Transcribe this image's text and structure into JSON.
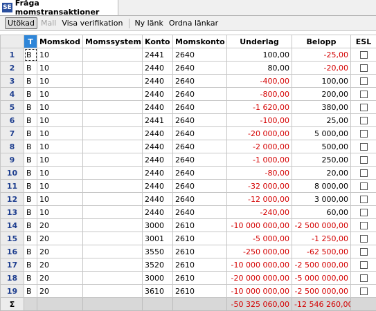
{
  "tab": {
    "icon_text": "SE",
    "title": "Fråga momstransaktioner"
  },
  "toolbar": {
    "expanded": "Utökad",
    "template": "Mall",
    "show_verification": "Visa verifikation",
    "new_link": "Ny länk",
    "arrange_links": "Ordna länkar"
  },
  "columns": {
    "t": "T",
    "momskod": "Momskod",
    "momssystem": "Momssystem",
    "konto": "Konto",
    "momskonto": "Momskonto",
    "underlag": "Underlag",
    "belopp": "Belopp",
    "esl": "ESL"
  },
  "rows": [
    {
      "n": "1",
      "t": "B",
      "kod": "10",
      "sys": "",
      "konto": "2441",
      "mk": "2640",
      "und": "100,00",
      "bel": "-25,00"
    },
    {
      "n": "2",
      "t": "B",
      "kod": "10",
      "sys": "",
      "konto": "2440",
      "mk": "2640",
      "und": "80,00",
      "bel": "-20,00"
    },
    {
      "n": "3",
      "t": "B",
      "kod": "10",
      "sys": "",
      "konto": "2440",
      "mk": "2640",
      "und": "-400,00",
      "bel": "100,00"
    },
    {
      "n": "4",
      "t": "B",
      "kod": "10",
      "sys": "",
      "konto": "2440",
      "mk": "2640",
      "und": "-800,00",
      "bel": "200,00"
    },
    {
      "n": "5",
      "t": "B",
      "kod": "10",
      "sys": "",
      "konto": "2440",
      "mk": "2640",
      "und": "-1 620,00",
      "bel": "380,00"
    },
    {
      "n": "6",
      "t": "B",
      "kod": "10",
      "sys": "",
      "konto": "2441",
      "mk": "2640",
      "und": "-100,00",
      "bel": "25,00"
    },
    {
      "n": "7",
      "t": "B",
      "kod": "10",
      "sys": "",
      "konto": "2440",
      "mk": "2640",
      "und": "-20 000,00",
      "bel": "5 000,00"
    },
    {
      "n": "8",
      "t": "B",
      "kod": "10",
      "sys": "",
      "konto": "2440",
      "mk": "2640",
      "und": "-2 000,00",
      "bel": "500,00"
    },
    {
      "n": "9",
      "t": "B",
      "kod": "10",
      "sys": "",
      "konto": "2440",
      "mk": "2640",
      "und": "-1 000,00",
      "bel": "250,00"
    },
    {
      "n": "10",
      "t": "B",
      "kod": "10",
      "sys": "",
      "konto": "2440",
      "mk": "2640",
      "und": "-80,00",
      "bel": "20,00"
    },
    {
      "n": "11",
      "t": "B",
      "kod": "10",
      "sys": "",
      "konto": "2440",
      "mk": "2640",
      "und": "-32 000,00",
      "bel": "8 000,00"
    },
    {
      "n": "12",
      "t": "B",
      "kod": "10",
      "sys": "",
      "konto": "2440",
      "mk": "2640",
      "und": "-12 000,00",
      "bel": "3 000,00"
    },
    {
      "n": "13",
      "t": "B",
      "kod": "10",
      "sys": "",
      "konto": "2440",
      "mk": "2640",
      "und": "-240,00",
      "bel": "60,00"
    },
    {
      "n": "14",
      "t": "B",
      "kod": "20",
      "sys": "",
      "konto": "3000",
      "mk": "2610",
      "und": "-10 000 000,00",
      "bel": "-2 500 000,00"
    },
    {
      "n": "15",
      "t": "B",
      "kod": "20",
      "sys": "",
      "konto": "3001",
      "mk": "2610",
      "und": "-5 000,00",
      "bel": "-1 250,00"
    },
    {
      "n": "16",
      "t": "B",
      "kod": "20",
      "sys": "",
      "konto": "3550",
      "mk": "2610",
      "und": "-250 000,00",
      "bel": "-62 500,00"
    },
    {
      "n": "17",
      "t": "B",
      "kod": "20",
      "sys": "",
      "konto": "3520",
      "mk": "2610",
      "und": "-10 000 000,00",
      "bel": "-2 500 000,00"
    },
    {
      "n": "18",
      "t": "B",
      "kod": "20",
      "sys": "",
      "konto": "3000",
      "mk": "2610",
      "und": "-20 000 000,00",
      "bel": "-5 000 000,00"
    },
    {
      "n": "19",
      "t": "B",
      "kod": "20",
      "sys": "",
      "konto": "3610",
      "mk": "2610",
      "und": "-10 000 000,00",
      "bel": "-2 500 000,00"
    }
  ],
  "totals": {
    "symbol": "Σ",
    "underlag": "-50 325 060,00",
    "belopp": "-12 546 260,00"
  },
  "colors": {
    "negative": "#d40000",
    "header_accent": "#2f86d8"
  }
}
